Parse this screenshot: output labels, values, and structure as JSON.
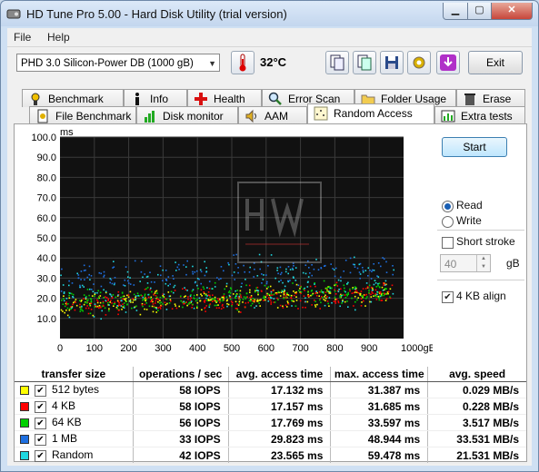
{
  "window": {
    "title": "HD Tune Pro 5.00 - Hard Disk Utility (trial version)"
  },
  "menu": {
    "file": "File",
    "help": "Help"
  },
  "toolbar": {
    "drive": "PHD 3.0 Silicon-Power DB (1000 gB)",
    "temperature": "32°C",
    "exit_label": "Exit"
  },
  "tabs_row1": [
    {
      "label": "Benchmark",
      "icon": "benchmark-icon"
    },
    {
      "label": "Info",
      "icon": "info-icon"
    },
    {
      "label": "Health",
      "icon": "health-icon"
    },
    {
      "label": "Error Scan",
      "icon": "error-scan-icon"
    },
    {
      "label": "Folder Usage",
      "icon": "folder-icon"
    },
    {
      "label": "Erase",
      "icon": "erase-icon"
    }
  ],
  "tabs_row2": [
    {
      "label": "File Benchmark",
      "icon": "file-benchmark-icon"
    },
    {
      "label": "Disk monitor",
      "icon": "disk-monitor-icon"
    },
    {
      "label": "AAM",
      "icon": "speaker-icon"
    },
    {
      "label": "Random Access",
      "icon": "random-access-icon",
      "active": true
    },
    {
      "label": "Extra tests",
      "icon": "extra-tests-icon"
    }
  ],
  "controls": {
    "start_label": "Start",
    "read_label": "Read",
    "write_label": "Write",
    "read_selected": true,
    "short_stroke_label": "Short stroke",
    "short_stroke_value": "40",
    "short_stroke_unit": "gB",
    "align_label": "4 KB align",
    "align_checked": true
  },
  "chart_data": {
    "type": "scatter",
    "y_unit": "ms",
    "x_unit": "gB",
    "ylim": [
      0,
      100
    ],
    "xlim": [
      0,
      1000
    ],
    "y_ticks": [
      "100.0",
      "90.0",
      "80.0",
      "70.0",
      "60.0",
      "50.0",
      "40.0",
      "30.0",
      "20.0",
      "10.0"
    ],
    "x_ticks": [
      "0",
      "100",
      "200",
      "300",
      "400",
      "500",
      "600",
      "700",
      "800",
      "900",
      "1000gB"
    ],
    "grid": true,
    "series": [
      {
        "color": "#ffff00",
        "mean_ms": 17.132,
        "max_ms": 31.387
      },
      {
        "color": "#ff0000",
        "mean_ms": 17.157,
        "max_ms": 31.685
      },
      {
        "color": "#00d000",
        "mean_ms": 17.769,
        "max_ms": 33.597
      },
      {
        "color": "#1e6fe0",
        "mean_ms": 29.823,
        "max_ms": 48.944
      },
      {
        "color": "#20d8e0",
        "mean_ms": 23.565,
        "max_ms": 59.478
      }
    ]
  },
  "results": {
    "headers": [
      "transfer size",
      "operations / sec",
      "avg. access time",
      "max. access time",
      "avg. speed"
    ],
    "rows": [
      {
        "size": "512 bytes",
        "color": "#ffff00",
        "iops": "58 IOPS",
        "avg": "17.132 ms",
        "max": "31.387 ms",
        "speed": "0.029 MB/s"
      },
      {
        "size": "4 KB",
        "color": "#ff0000",
        "iops": "58 IOPS",
        "avg": "17.157 ms",
        "max": "31.685 ms",
        "speed": "0.228 MB/s"
      },
      {
        "size": "64 KB",
        "color": "#00d000",
        "iops": "56 IOPS",
        "avg": "17.769 ms",
        "max": "33.597 ms",
        "speed": "3.517 MB/s"
      },
      {
        "size": "1 MB",
        "color": "#1e6fe0",
        "iops": "33 IOPS",
        "avg": "29.823 ms",
        "max": "48.944 ms",
        "speed": "33.531 MB/s"
      },
      {
        "size": "Random",
        "color": "#20d8e0",
        "iops": "42 IOPS",
        "avg": "23.565 ms",
        "max": "59.478 ms",
        "speed": "21.531 MB/s"
      }
    ]
  }
}
